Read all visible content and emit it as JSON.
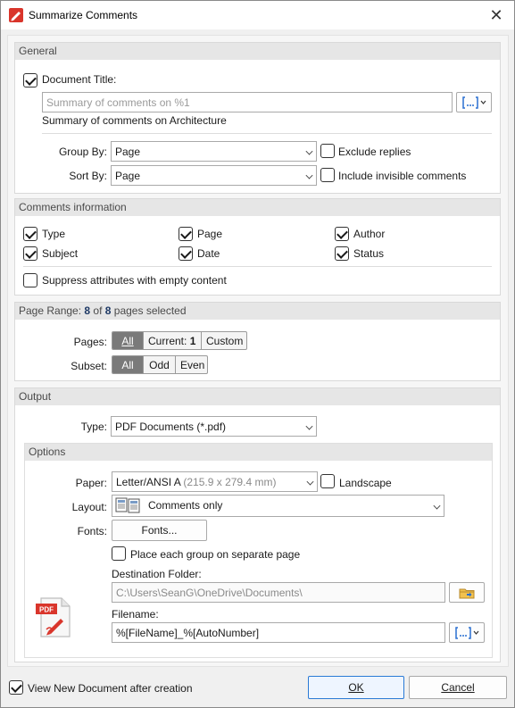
{
  "window": {
    "title": "Summarize Comments"
  },
  "general": {
    "header": "General",
    "doc_title_label": "Document Title:",
    "doc_title_placeholder": "Summary of comments on %1",
    "doc_title_preview": "Summary of comments on Architecture",
    "group_by_label": "Group By:",
    "group_by_value": "Page",
    "sort_by_label": "Sort By:",
    "sort_by_value": "Page",
    "exclude_replies": "Exclude replies",
    "include_invisible": "Include invisible comments"
  },
  "comments_info": {
    "header": "Comments information",
    "fields": {
      "type": "Type",
      "page": "Page",
      "author": "Author",
      "subject": "Subject",
      "date": "Date",
      "status": "Status"
    },
    "suppress": "Suppress attributes with empty content"
  },
  "page_range": {
    "header_prefix": "Page Range: ",
    "selected": "8",
    "mid": " of ",
    "total": "8",
    "suffix": " pages selected",
    "pages_label": "Pages:",
    "pages_all": "All",
    "pages_current": "Current:",
    "pages_current_num": "1",
    "pages_custom": "Custom",
    "subset_label": "Subset:",
    "subset_all": "All",
    "subset_odd": "Odd",
    "subset_even": "Even"
  },
  "output": {
    "header": "Output",
    "type_label": "Type:",
    "type_value": "PDF Documents (*.pdf)",
    "options_header": "Options",
    "paper_label": "Paper:",
    "paper_value": "Letter/ANSI A",
    "paper_dims": "(215.9 x 279.4 mm)",
    "landscape": "Landscape",
    "layout_label": "Layout:",
    "layout_value": "Comments only",
    "fonts_label": "Fonts:",
    "fonts_button": "Fonts...",
    "separate_page": "Place each group on separate page",
    "dest_label": "Destination Folder:",
    "dest_value": "C:\\Users\\SeanG\\OneDrive\\Documents\\",
    "filename_label": "Filename:",
    "filename_value": "%[FileName]_%[AutoNumber]",
    "pdf_badge": "PDF"
  },
  "footer": {
    "view_after": "View New Document after creation",
    "ok": "OK",
    "cancel": "Cancel"
  },
  "colors": {
    "accent": "#2a7ad5",
    "pdf_red": "#d9352b",
    "header_bg": "#e6e6e6"
  }
}
